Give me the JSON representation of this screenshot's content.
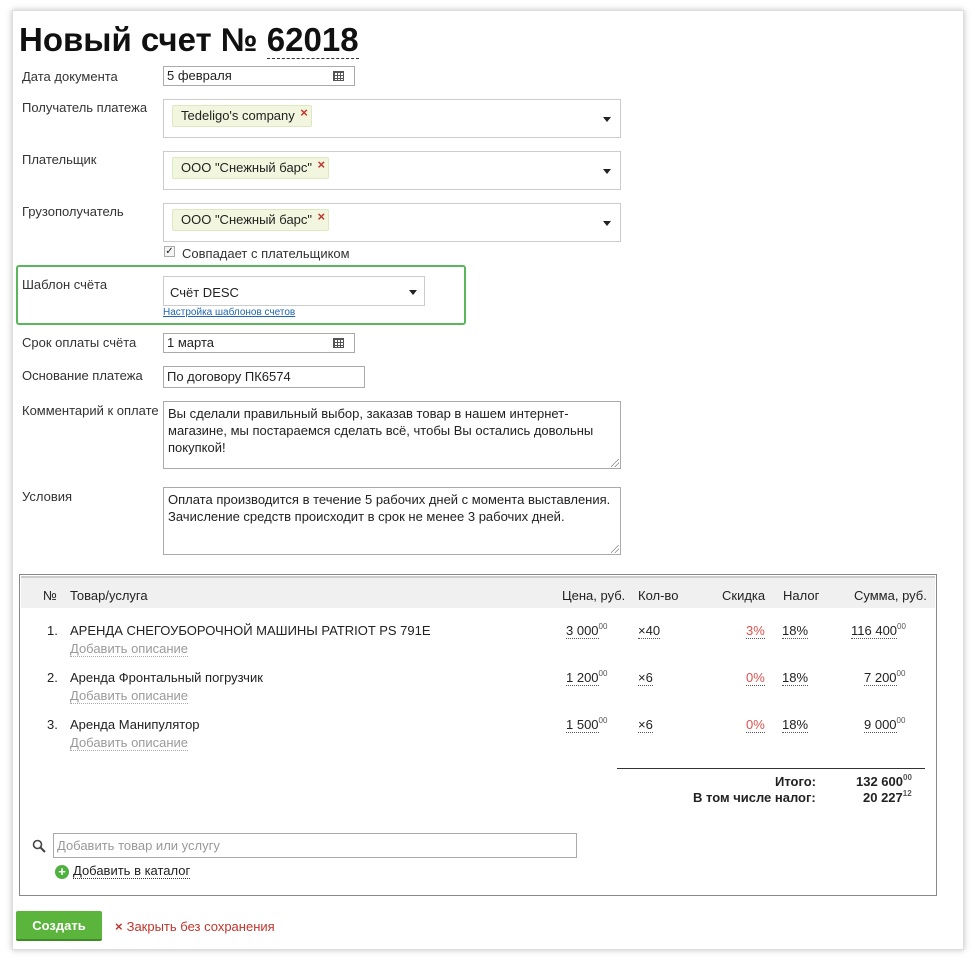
{
  "header": {
    "title": "Новый счет №",
    "number": "62018"
  },
  "form": {
    "date_label": "Дата документа",
    "date_value": "5 февраля",
    "recipient_label": "Получатель платежа",
    "recipient_tag": "Tedeligo's company",
    "payer_label": "Плательщик",
    "payer_tag": "ООО \"Снежный барс\"",
    "consignee_label": "Грузополучатель",
    "consignee_tag": "ООО \"Снежный барс\"",
    "same_as_payer_label": "Совпадает с плательщиком",
    "same_as_payer_checked": true,
    "template_label": "Шаблон счёта",
    "template_value": "Счёт DESC",
    "template_settings_link": "Настройка шаблонов счетов",
    "due_label": "Срок оплаты счёта",
    "due_value": "1 марта",
    "basis_label": "Основание платежа",
    "basis_value": "По договору ПК6574",
    "comment_label": "Комментарий к оплате",
    "comment_line1": "Вы сделали правильный выбор, заказав товар в нашем интернет-",
    "comment_line2": "магазине, мы постараемся сделать всё, чтобы Вы остались довольны",
    "comment_line3": "покупкой!",
    "terms_label": "Условия",
    "terms_line1": "Оплата производится в течение 5 рабочих дней с момента выставления.",
    "terms_line2": "Зачисление средств происходит в срок не менее 3 рабочих дней."
  },
  "table": {
    "headers": {
      "num": "№",
      "product": "Товар/услуга",
      "price": "Цена, руб.",
      "qty": "Кол-во",
      "discount": "Скидка",
      "tax": "Налог",
      "sum": "Сумма, руб."
    },
    "rows": [
      {
        "num": "1.",
        "name": "АРЕНДА СНЕГОУБОРОЧНОЙ МАШИНЫ PATRIOT PS 791E",
        "desc": "Добавить описание",
        "price": "3 000",
        "price_cents": "00",
        "qty": "×40",
        "discount": "3%",
        "tax": "18%",
        "sum": "116 400",
        "sum_cents": "00"
      },
      {
        "num": "2.",
        "name": "Аренда Фронтальный погрузчик",
        "desc": "Добавить описание",
        "price": "1 200",
        "price_cents": "00",
        "qty": "×6",
        "discount": "0%",
        "tax": "18%",
        "sum": "7 200",
        "sum_cents": "00"
      },
      {
        "num": "3.",
        "name": "Аренда Манипулятор",
        "desc": "Добавить описание",
        "price": "1 500",
        "price_cents": "00",
        "qty": "×6",
        "discount": "0%",
        "tax": "18%",
        "sum": "9 000",
        "sum_cents": "00"
      }
    ],
    "total_label": "Итого:",
    "total_value": "132 600",
    "total_cents": "00",
    "tax_total_label": "В том числе налог:",
    "tax_total_value": "20 227",
    "tax_total_cents": "12",
    "add_placeholder": "Добавить товар или услугу",
    "add_catalog": "Добавить в каталог"
  },
  "actions": {
    "create": "Создать",
    "close": "Закрыть без сохранения"
  },
  "colors": {
    "accent": "#5bb53d",
    "link": "#2067b0",
    "danger": "#c0352b",
    "highlight": "#5ab65a"
  }
}
